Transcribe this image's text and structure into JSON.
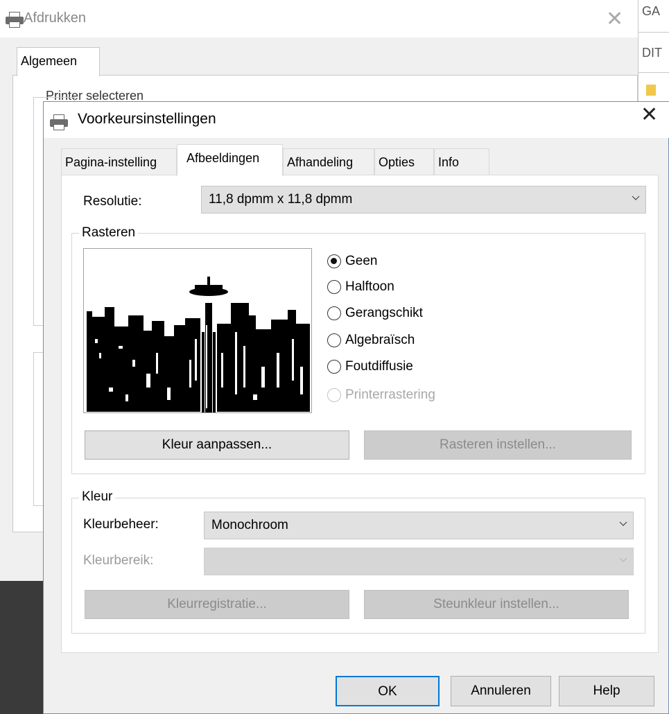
{
  "background_window": {
    "title": "Afdrukken",
    "close_symbol": "✕",
    "tab_label": "Algemeen",
    "partial_group_label": "Printer selecteren",
    "side_text_1": "GA",
    "side_text_2": "DIT"
  },
  "dialog": {
    "title": "Voorkeursinstellingen",
    "close_symbol": "✕",
    "icon": "printer-icon"
  },
  "tabs": [
    {
      "label": "Pagina-instelling",
      "active": false
    },
    {
      "label": "Afbeeldingen",
      "active": true
    },
    {
      "label": "Afhandeling",
      "active": false
    },
    {
      "label": "Opties",
      "active": false
    },
    {
      "label": "Info",
      "active": false
    }
  ],
  "resolution": {
    "label": "Resolutie:",
    "value": "11,8 dpmm x 11,8 dpmm"
  },
  "dithering": {
    "group_label": "Rasteren",
    "preview": "skyline-preview-image",
    "options": [
      {
        "label": "Geen",
        "checked": true,
        "enabled": true
      },
      {
        "label": "Halftoon",
        "checked": false,
        "enabled": true
      },
      {
        "label": "Gerangschikt",
        "checked": false,
        "enabled": true
      },
      {
        "label": "Algebraïsch",
        "checked": false,
        "enabled": true
      },
      {
        "label": "Foutdiffusie",
        "checked": false,
        "enabled": true
      },
      {
        "label": "Printerrastering",
        "checked": false,
        "enabled": false
      }
    ],
    "adjust_button": "Kleur aanpassen...",
    "settings_button": "Rasteren instellen..."
  },
  "color": {
    "group_label": "Kleur",
    "management_label": "Kleurbeheer:",
    "management_value": "Monochroom",
    "range_label": "Kleurbereik:",
    "range_value": "",
    "calibration_button": "Kleurregistratie...",
    "spot_button": "Steunkleur instellen..."
  },
  "footer": {
    "ok": "OK",
    "cancel": "Annuleren",
    "help": "Help"
  },
  "colors": {
    "focus_border": "#0078d7",
    "dialog_bg": "#f0f0f0",
    "disabled_text": "#9a9a9a"
  }
}
